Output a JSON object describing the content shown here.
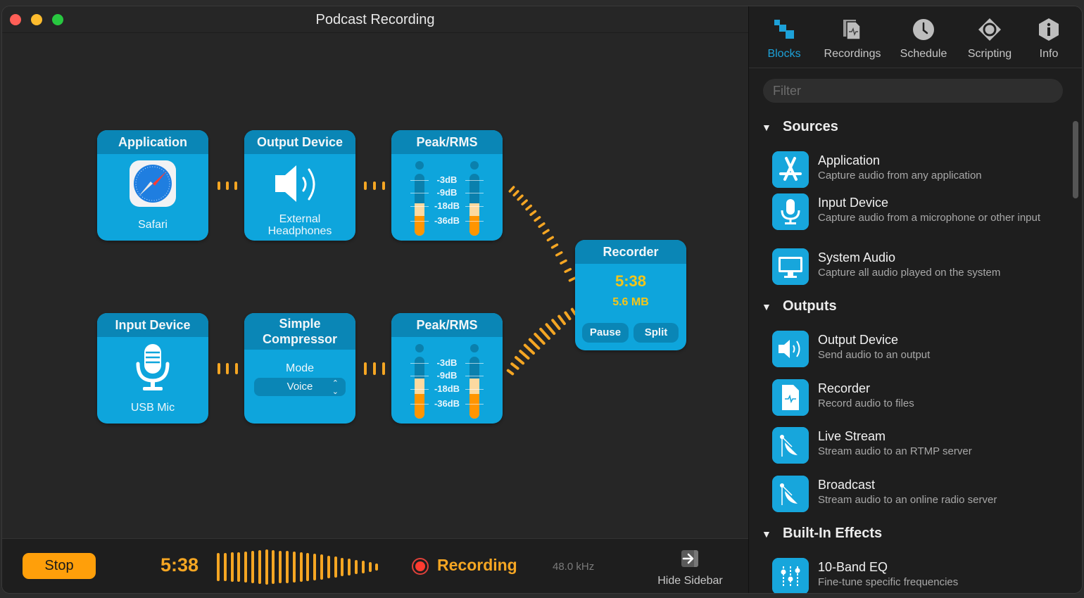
{
  "window": {
    "title": "Podcast Recording"
  },
  "blocks": {
    "application": {
      "title": "Application",
      "label": "Safari",
      "icon": "safari-compass-icon"
    },
    "output_device": {
      "title": "Output Device",
      "label_line1": "External",
      "label_line2": "Headphones",
      "icon": "speaker-icon"
    },
    "peak_top": {
      "title": "Peak/RMS",
      "db": [
        "-3dB",
        "-9dB",
        "-18dB",
        "-36dB"
      ],
      "level_left": 0.52,
      "level_right": 0.52
    },
    "input_device": {
      "title": "Input Device",
      "label": "USB Mic",
      "icon": "microphone-icon"
    },
    "compressor": {
      "title_line1": "Simple",
      "title_line2": "Compressor",
      "mode_label": "Mode",
      "mode_value": "Voice"
    },
    "peak_bottom": {
      "title": "Peak/RMS",
      "db": [
        "-3dB",
        "-9dB",
        "-18dB",
        "-36dB"
      ],
      "level_left": 0.65,
      "level_right": 0.65
    },
    "recorder": {
      "title": "Recorder",
      "time": "5:38",
      "size": "5.6 MB",
      "pause_label": "Pause",
      "split_label": "Split"
    }
  },
  "bottom_bar": {
    "stop_label": "Stop",
    "time": "5:38",
    "status": "Recording",
    "sample_rate": "48.0 kHz",
    "hide_sidebar_label": "Hide Sidebar"
  },
  "colors": {
    "accent_blue": "#0ea5dc",
    "accent_orange": "#f5a623",
    "record_red": "#ff3b30"
  },
  "sidebar": {
    "tabs": [
      {
        "label": "Blocks",
        "icon": "blocks-icon",
        "active": true
      },
      {
        "label": "Recordings",
        "icon": "recordings-icon",
        "active": false
      },
      {
        "label": "Schedule",
        "icon": "clock-icon",
        "active": false
      },
      {
        "label": "Scripting",
        "icon": "scripting-icon",
        "active": false
      },
      {
        "label": "Info",
        "icon": "info-icon",
        "active": false
      }
    ],
    "filter_placeholder": "Filter",
    "sections": [
      {
        "title": "Sources",
        "items": [
          {
            "title": "Application",
            "desc": "Capture audio from any application",
            "icon": "app-store-icon"
          },
          {
            "title": "Input Device",
            "desc": "Capture audio from a microphone or other input",
            "icon": "microphone-icon"
          },
          {
            "title": "System Audio",
            "desc": "Capture all audio played on the system",
            "icon": "monitor-icon"
          }
        ]
      },
      {
        "title": "Outputs",
        "items": [
          {
            "title": "Output Device",
            "desc": "Send audio to an output",
            "icon": "speaker-icon"
          },
          {
            "title": "Recorder",
            "desc": "Record audio to files",
            "icon": "audio-file-icon"
          },
          {
            "title": "Live Stream",
            "desc": "Stream audio to an RTMP server",
            "icon": "satellite-dish-icon"
          },
          {
            "title": "Broadcast",
            "desc": "Stream audio to an online radio server",
            "icon": "satellite-dish-icon"
          }
        ]
      },
      {
        "title": "Built-In Effects",
        "items": [
          {
            "title": "10-Band EQ",
            "desc": "Fine-tune specific frequencies",
            "icon": "equalizer-sliders-icon"
          }
        ]
      }
    ]
  }
}
